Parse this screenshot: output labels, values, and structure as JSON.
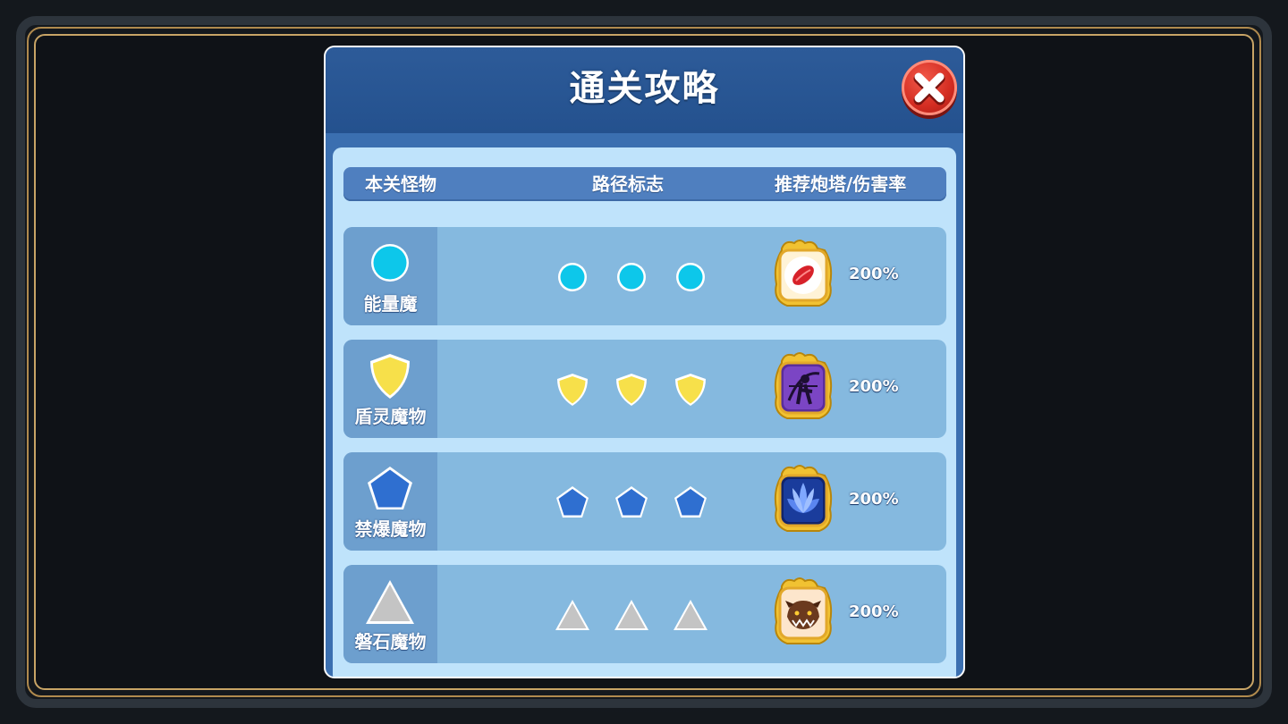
{
  "panel": {
    "title": "通关攻略",
    "close_icon": "close-x-icon"
  },
  "columns": {
    "monster": "本关怪物",
    "path": "路径标志",
    "tower": "推荐炮塔/伤害率"
  },
  "rows": [
    {
      "name": "能量魔",
      "shape": "circle",
      "color": "#0dc7ea",
      "tower_icon": "red-flame-tower-icon",
      "rate": "200%"
    },
    {
      "name": "盾灵魔物",
      "shape": "shield",
      "color": "#f7e04a",
      "tower_icon": "purple-archer-tower-icon",
      "rate": "200%"
    },
    {
      "name": "禁爆魔物",
      "shape": "pentagon",
      "color": "#2f6fd0",
      "tower_icon": "blue-lotus-tower-icon",
      "rate": "200%"
    },
    {
      "name": "磐石魔物",
      "shape": "triangle",
      "color": "#c4c4c4",
      "tower_icon": "brown-beast-tower-icon",
      "rate": "200%"
    }
  ],
  "colors": {
    "header_blue": "#2d5b99",
    "body_light": "#bfe3fb",
    "row_blue": "#85b9df",
    "frame_gold": "#c8a466"
  }
}
